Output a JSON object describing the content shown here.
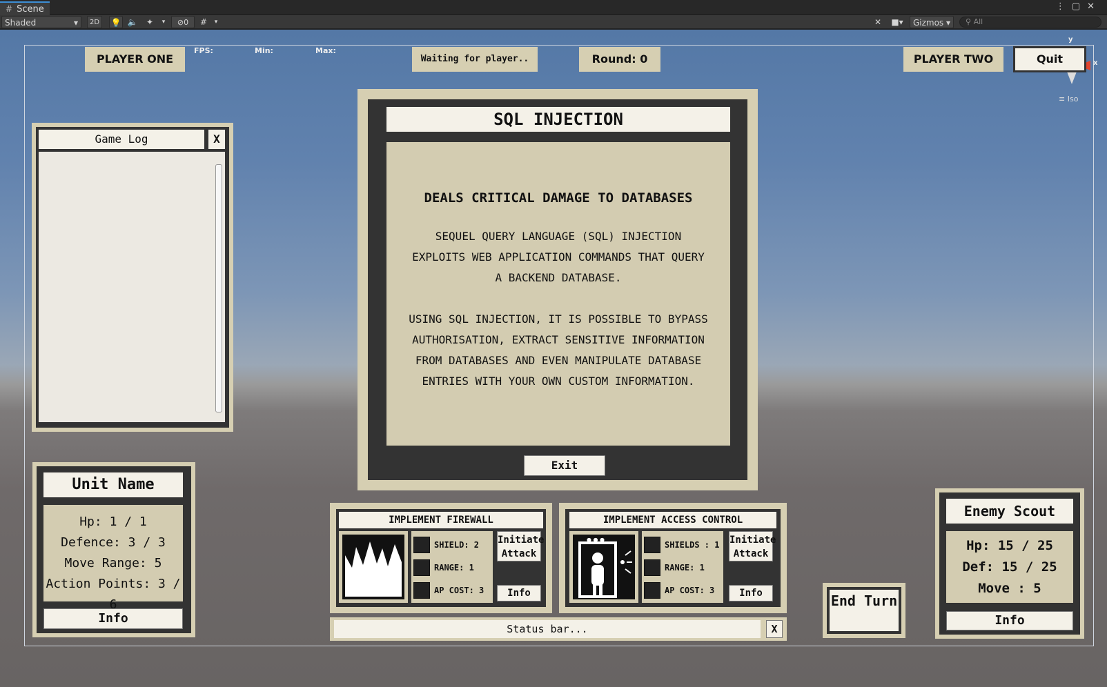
{
  "editor": {
    "tab_title": "Scene",
    "shading_mode": "Shaded",
    "toggle_2d": "2D",
    "hidden_count": "0",
    "gizmos_label": "Gizmos",
    "search_placeholder": "All",
    "iso_label": "Iso",
    "axis_y": "y",
    "axis_x": "x"
  },
  "hud": {
    "player_one": "PLAYER ONE",
    "player_two": "PLAYER TWO",
    "fps_label": "FPS:",
    "min_label": "Min:",
    "max_label": "Max:",
    "waiting": "Waiting for player..",
    "round": "Round: 0",
    "quit": "Quit"
  },
  "game_log": {
    "title": "Game Log",
    "close": "X"
  },
  "card_info": {
    "title": "SQL INJECTION",
    "headline": "DEALS CRITICAL DAMAGE TO DATABASES",
    "paragraph1": "Sequel Query Language (SQL) injection exploits web application commands that query a backend database.",
    "paragraph2": "Using SQL injection, it is possible to bypass authorisation, extract sensitive information from databases and even manipulate database entries with your own custom information.",
    "exit": "Exit"
  },
  "unit_panel": {
    "name": "Unit Name",
    "hp": "Hp: 1 / 1",
    "defence": "Defence: 3 / 3",
    "move_range": "Move Range: 5",
    "action_points": "Action Points: 3 / 6",
    "info": "Info"
  },
  "cards": [
    {
      "title": "Implement Firewall",
      "shield": "SHIELD: 2",
      "range": "RANGE: 1",
      "ap_cost": "AP COST: 3",
      "attack": "Initiate Attack",
      "info": "Info",
      "art": "flame-icon"
    },
    {
      "title": "Implement Access Control",
      "shield": "SHIELDS : 1",
      "range": "RANGE: 1",
      "ap_cost": "AP COST: 3",
      "attack": "Initiate Attack",
      "info": "Info",
      "art": "person-in-door-icon"
    }
  ],
  "status_bar": {
    "text": "Status bar...",
    "close": "X"
  },
  "end_turn": "End Turn",
  "enemy_panel": {
    "name": "Enemy Scout",
    "hp": "Hp: 15 / 25",
    "def": "Def: 15 / 25",
    "move": "Move : 5",
    "info": "Info"
  },
  "colors": {
    "panel_beige": "#d6cfb2",
    "panel_dark": "#333333",
    "sky": "#5478a6",
    "ground": "#6f6a6a"
  }
}
